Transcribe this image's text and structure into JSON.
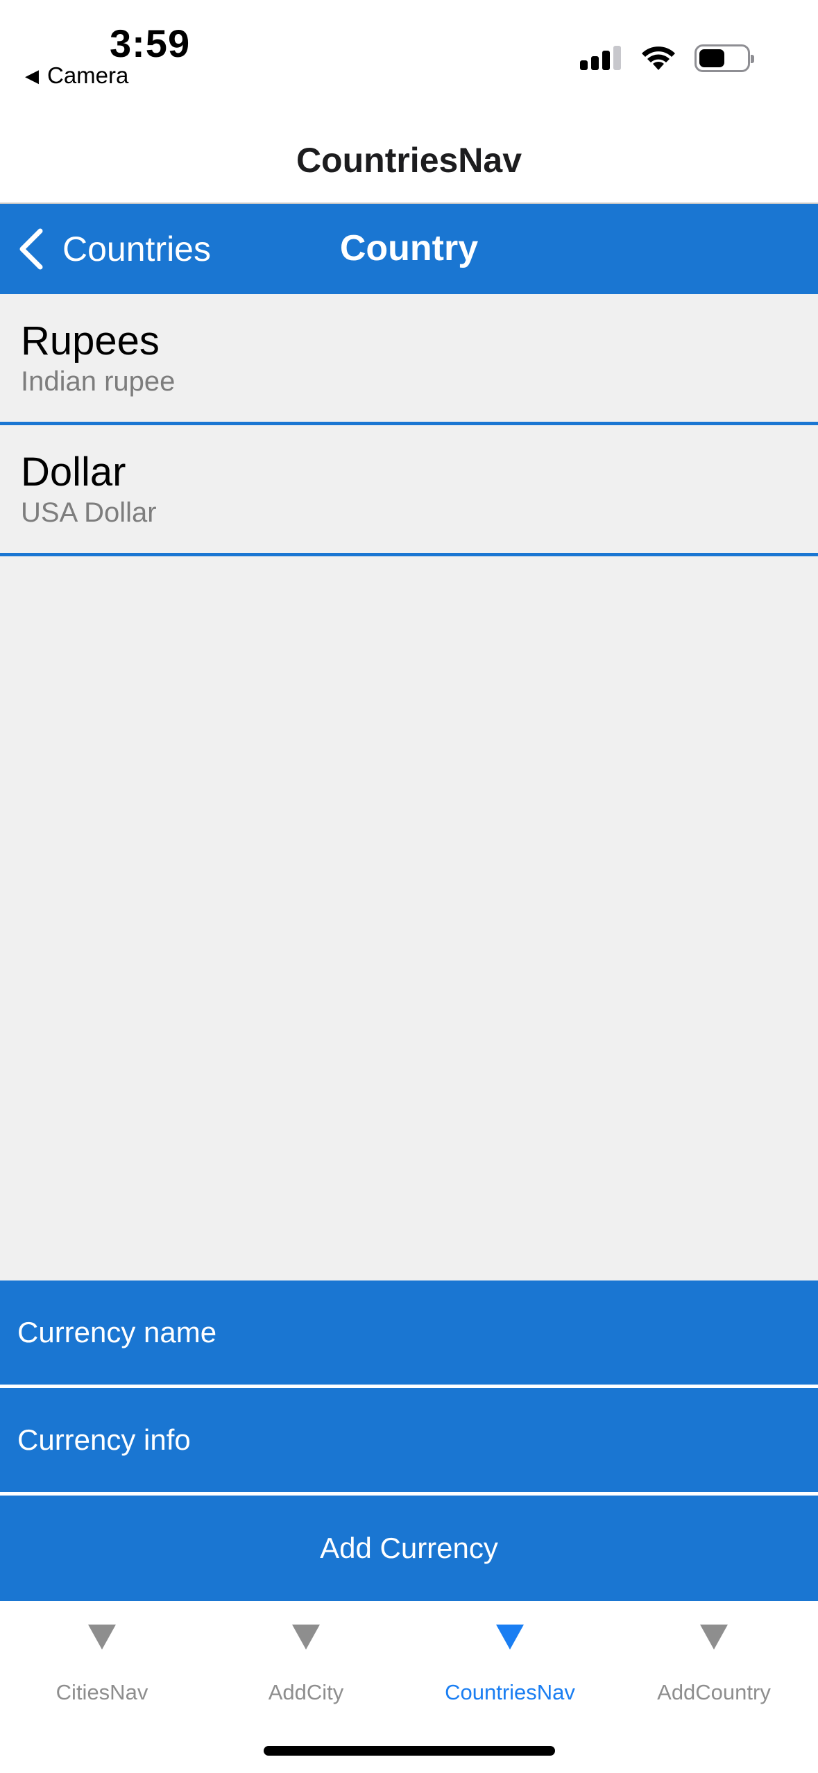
{
  "status_bar": {
    "time": "3:59",
    "back_app_label": "Camera",
    "back_app_icon": "back-triangle-icon",
    "icons": [
      "cellular-signal-icon",
      "wifi-icon",
      "battery-icon"
    ]
  },
  "tab_page": {
    "title": "CountriesNav"
  },
  "nav_bar": {
    "back_label": "Countries",
    "back_icon": "chevron-left-icon",
    "title": "Country",
    "color": "#1a76d2"
  },
  "currencies": [
    {
      "name": "Rupees",
      "info": "Indian rupee"
    },
    {
      "name": "Dollar",
      "info": "USA Dollar"
    }
  ],
  "form": {
    "currency_name_placeholder": "Currency name",
    "currency_info_placeholder": "Currency info",
    "add_button_label": "Add Currency"
  },
  "tab_bar": {
    "active_color": "#1a7ef2",
    "inactive_color": "#8e8e8e",
    "tabs": [
      {
        "label": "CitiesNav",
        "icon": "triangle-down-icon",
        "active": false
      },
      {
        "label": "AddCity",
        "icon": "triangle-down-icon",
        "active": false
      },
      {
        "label": "CountriesNav",
        "icon": "triangle-down-icon",
        "active": true
      },
      {
        "label": "AddCountry",
        "icon": "triangle-down-icon",
        "active": false
      }
    ]
  }
}
